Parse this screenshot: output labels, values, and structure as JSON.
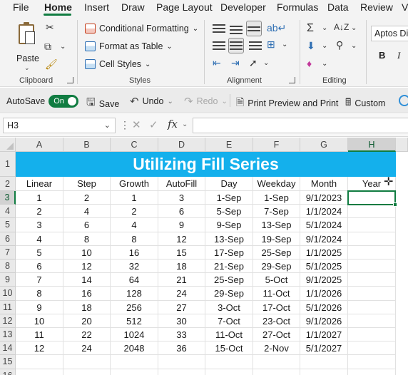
{
  "menu": {
    "tabs": [
      "File",
      "Home",
      "Insert",
      "Draw",
      "Page Layout",
      "Developer",
      "Formulas",
      "Data",
      "Review",
      "V"
    ],
    "active": "Home"
  },
  "ribbon": {
    "clipboard": {
      "paste": "Paste",
      "group_label": "Clipboard"
    },
    "styles": {
      "conditional_formatting": "Conditional Formatting",
      "format_as_table": "Format as Table",
      "cell_styles": "Cell Styles",
      "group_label": "Styles"
    },
    "alignment": {
      "group_label": "Alignment"
    },
    "editing": {
      "group_label": "Editing"
    },
    "font": {
      "name": "Aptos Di",
      "bold": "B",
      "italic": "I"
    }
  },
  "qat": {
    "autosave_label": "AutoSave",
    "autosave_state": "On",
    "save": "Save",
    "undo": "Undo",
    "redo": "Redo",
    "print_preview": "Print Preview and Print",
    "custom": "Custom"
  },
  "formula_bar": {
    "name_box": "H3",
    "fx": "fx",
    "formula": ""
  },
  "sheet": {
    "columns": [
      "A",
      "B",
      "C",
      "D",
      "E",
      "F",
      "G",
      "H"
    ],
    "selected_column": "H",
    "selected_row": "3",
    "title": "Utilizing Fill Series",
    "headers": [
      "Linear",
      "Step",
      "Growth",
      "AutoFill",
      "Day",
      "Weekday",
      "Month",
      "Year"
    ],
    "row_numbers": [
      "1",
      "2",
      "3",
      "4",
      "5",
      "6",
      "7",
      "8",
      "9",
      "10",
      "11",
      "12",
      "13",
      "14",
      "15",
      "16"
    ],
    "rows": [
      [
        "1",
        "2",
        "1",
        "3",
        "1-Sep",
        "1-Sep",
        "9/1/2023",
        ""
      ],
      [
        "2",
        "4",
        "2",
        "6",
        "5-Sep",
        "7-Sep",
        "1/1/2024",
        ""
      ],
      [
        "3",
        "6",
        "4",
        "9",
        "9-Sep",
        "13-Sep",
        "5/1/2024",
        ""
      ],
      [
        "4",
        "8",
        "8",
        "12",
        "13-Sep",
        "19-Sep",
        "9/1/2024",
        ""
      ],
      [
        "5",
        "10",
        "16",
        "15",
        "17-Sep",
        "25-Sep",
        "1/1/2025",
        ""
      ],
      [
        "6",
        "12",
        "32",
        "18",
        "21-Sep",
        "29-Sep",
        "5/1/2025",
        ""
      ],
      [
        "7",
        "14",
        "64",
        "21",
        "25-Sep",
        "5-Oct",
        "9/1/2025",
        ""
      ],
      [
        "8",
        "16",
        "128",
        "24",
        "29-Sep",
        "11-Oct",
        "1/1/2026",
        ""
      ],
      [
        "9",
        "18",
        "256",
        "27",
        "3-Oct",
        "17-Oct",
        "5/1/2026",
        ""
      ],
      [
        "10",
        "20",
        "512",
        "30",
        "7-Oct",
        "23-Oct",
        "9/1/2026",
        ""
      ],
      [
        "11",
        "22",
        "1024",
        "33",
        "11-Oct",
        "27-Oct",
        "1/1/2027",
        ""
      ],
      [
        "12",
        "24",
        "2048",
        "36",
        "15-Oct",
        "2-Nov",
        "5/1/2027",
        ""
      ]
    ]
  },
  "colors": {
    "accent": "#107c41",
    "title_fill": "#14b0ec",
    "title_text": "#ffffff"
  }
}
